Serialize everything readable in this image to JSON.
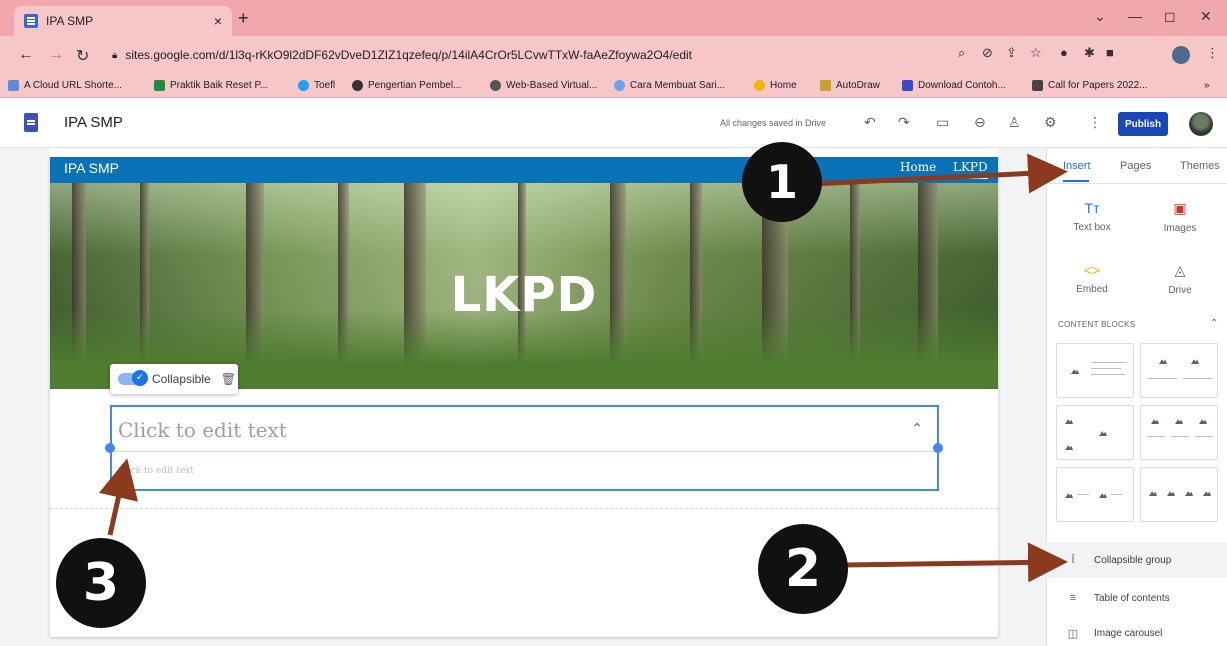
{
  "browser": {
    "tab_title": "IPA SMP",
    "tab_close": "×",
    "new_tab": "+",
    "url": "sites.google.com/d/1l3q-rKkO9l2dDF62vDveD1ZIZ1qzefeq/p/14ilA4CrOr5LCvwTTxW-faAeZfoywa2O4/edit",
    "bookmarks": [
      "A Cloud URL Shorte...",
      "Praktik Baik Reset P...",
      "Toefl",
      "Pengertian Pembel...",
      "Web-Based Virtual...",
      "Cara Membuat Sari...",
      "Home",
      "AutoDraw",
      "Download Contoh...",
      "Call for Papers 2022..."
    ]
  },
  "app": {
    "title": "IPA SMP",
    "saved_status": "All changes saved in Drive",
    "publish_label": "Publish"
  },
  "site": {
    "name": "IPA SMP",
    "nav": [
      "Home",
      "LKPD"
    ],
    "hero_title": "LKPD"
  },
  "collapsible": {
    "toolbar_label": "Collapsible",
    "title_placeholder": "Click to edit text",
    "body_placeholder": "Click to edit text"
  },
  "panel": {
    "tabs": [
      "Insert",
      "Pages",
      "Themes"
    ],
    "insert_items": [
      {
        "label": "Text box",
        "icon": "Tт"
      },
      {
        "label": "Images",
        "icon": "▣"
      },
      {
        "label": "Embed",
        "icon": "<>"
      },
      {
        "label": "Drive",
        "icon": "◬"
      }
    ],
    "content_blocks_label": "CONTENT BLOCKS",
    "list_items": [
      {
        "label": "Collapsible group",
        "icon": "Ī"
      },
      {
        "label": "Table of contents",
        "icon": "≡"
      },
      {
        "label": "Image carousel",
        "icon": "◫"
      }
    ]
  },
  "annotations": [
    "1",
    "2",
    "3"
  ],
  "colors": {
    "browser_chrome": "#f7c6c9",
    "site_nav": "#0a73b8",
    "accent": "#1a73e8",
    "publish": "#1a47b8",
    "arrow": "#8b3a1e"
  }
}
